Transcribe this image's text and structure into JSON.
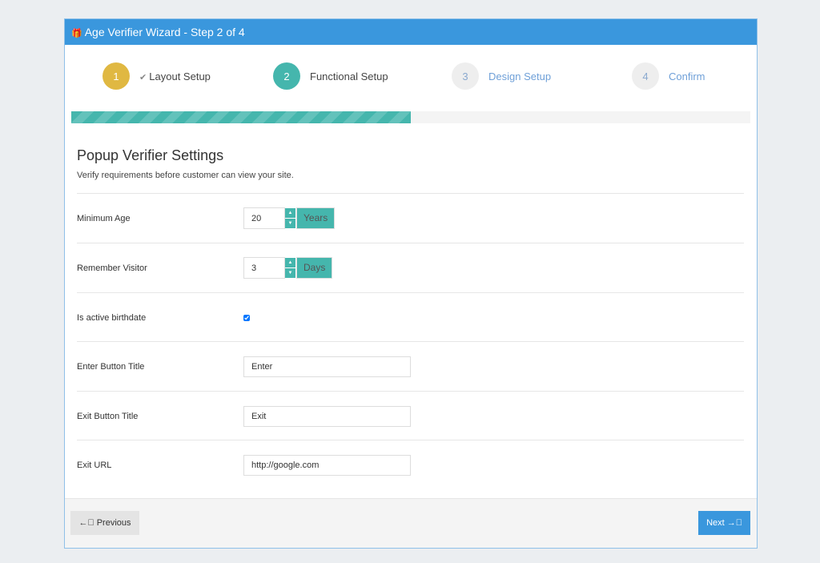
{
  "header": {
    "title": "Age Verifier Wizard - Step 2 of 4",
    "icon": "gift-icon"
  },
  "steps": [
    {
      "num": "1",
      "label": "Layout Setup",
      "state": "done",
      "color": "#e0b842"
    },
    {
      "num": "2",
      "label": "Functional Setup",
      "state": "active",
      "color": "#45b6ad"
    },
    {
      "num": "3",
      "label": "Design Setup",
      "state": "pending",
      "color": "#eeeeee"
    },
    {
      "num": "4",
      "label": "Confirm",
      "state": "pending",
      "color": "#eeeeee"
    }
  ],
  "progress_percent": 50,
  "section": {
    "title": "Popup Verifier Settings",
    "subtitle": "Verify requirements before customer can view your site."
  },
  "fields": {
    "min_age": {
      "label": "Minimum Age",
      "value": "20",
      "unit": "Years"
    },
    "remember": {
      "label": "Remember Visitor",
      "value": "3",
      "unit": "Days"
    },
    "birthdate": {
      "label": "Is active birthdate",
      "checked": true
    },
    "enter": {
      "label": "Enter Button Title",
      "value": "Enter"
    },
    "exit": {
      "label": "Exit Button Title",
      "value": "Exit"
    },
    "url": {
      "label": "Exit URL",
      "value": "http://google.com"
    }
  },
  "footer": {
    "previous": "Previous",
    "next": "Next"
  }
}
